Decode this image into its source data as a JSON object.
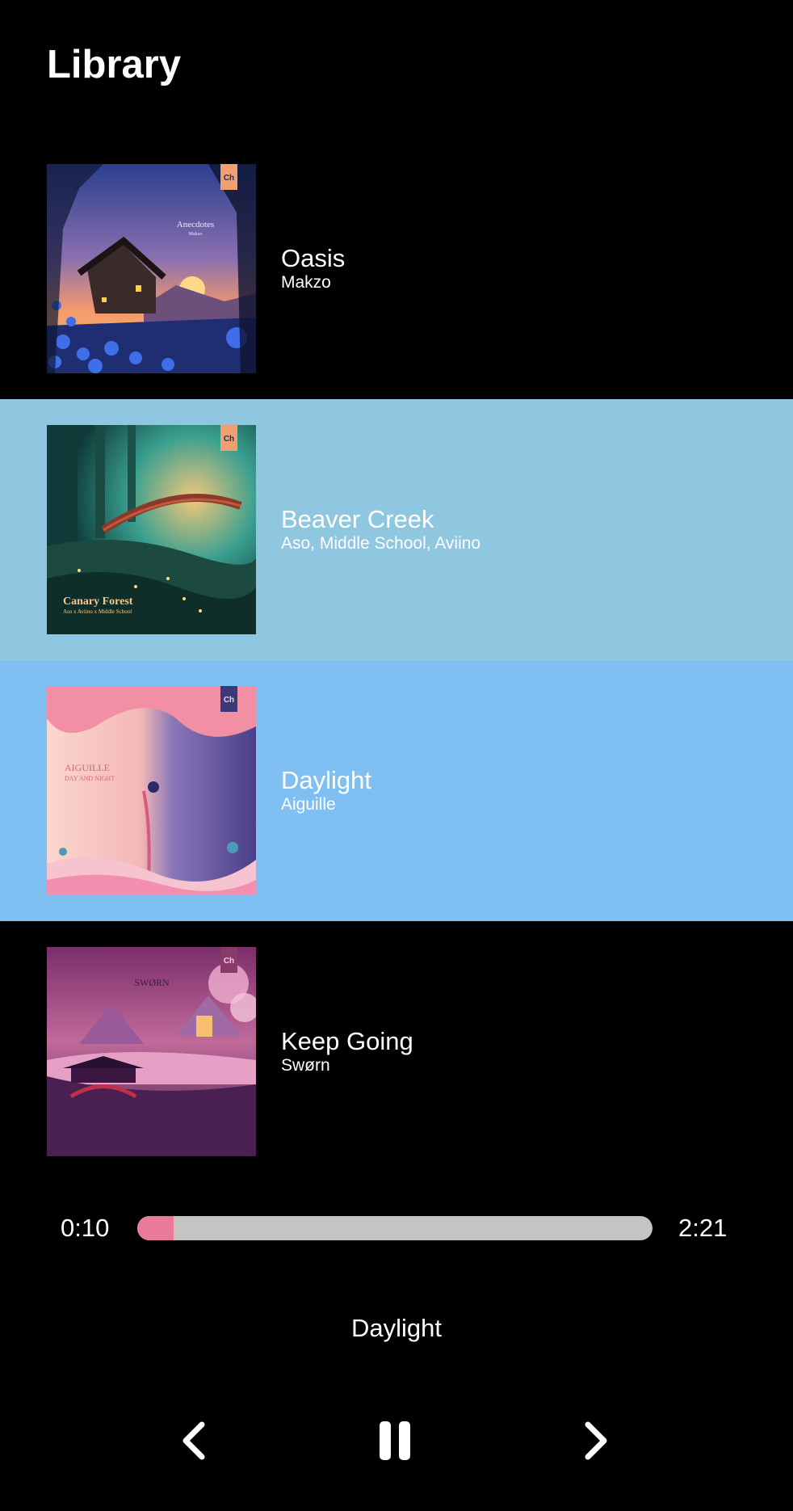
{
  "header": {
    "title": "Library"
  },
  "tracks": [
    {
      "title": "Oasis",
      "artist": "Makzo",
      "row_bg": "#000000",
      "cover": {
        "label": "Anecdotes",
        "sublabel": "Makzo",
        "badge": "Ch"
      }
    },
    {
      "title": "Beaver Creek",
      "artist": "Aso, Middle School, Aviino",
      "row_bg": "#8fc6e0",
      "cover": {
        "label": "Canary Forest",
        "sublabel": "Aso x Aviino x Middle School",
        "badge": "Ch"
      }
    },
    {
      "title": "Daylight",
      "artist": "Aiguille",
      "row_bg": "#7fbff1",
      "cover": {
        "label": "AIGUILLE",
        "sublabel": "DAY AND NIGHT",
        "badge": "Ch"
      }
    },
    {
      "title": "Keep Going",
      "artist": "Swørn",
      "row_bg": "#000000",
      "cover": {
        "label": "SWØRN",
        "sublabel": "",
        "badge": "Ch"
      }
    }
  ],
  "player": {
    "current_time": "0:10",
    "total_time": "2:21",
    "progress_fraction": 0.071,
    "progress_color": "#ea7a99",
    "track_color": "#c4c4c4",
    "now_playing": "Daylight"
  },
  "controls": {
    "prev_icon": "chevron-left-icon",
    "pause_icon": "pause-icon",
    "next_icon": "chevron-right-icon"
  }
}
